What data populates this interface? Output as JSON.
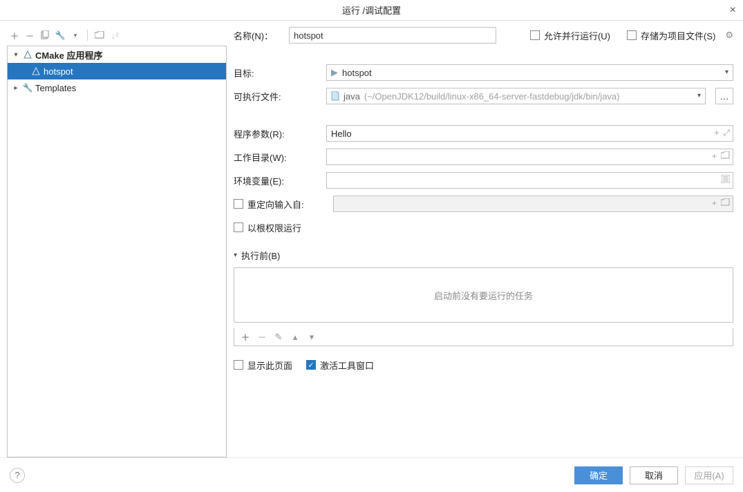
{
  "title": "运行 /调试配置",
  "toolbar": {
    "add": "+",
    "remove": "−",
    "copy": "⧉",
    "settings": "🔧"
  },
  "tree": {
    "cmake_apps": "CMake 应用程序",
    "hotspot": "hotspot",
    "templates": "Templates"
  },
  "form": {
    "name_label": "名称(N)：",
    "name_value": "hotspot",
    "allow_parallel": "允许并行运行(U)",
    "store_as_project": "存储为项目文件(S)",
    "target_label": "目标:",
    "target_value": "hotspot",
    "executable_label": "可执行文件:",
    "executable_name": "java",
    "executable_path": "(~/OpenJDK12/build/linux-x86_64-server-fastdebug/jdk/bin/java)",
    "args_label": "程序参数(R):",
    "args_value": "Hello",
    "wd_label": "工作目录(W):",
    "wd_value": "",
    "env_label": "环境变量(E):",
    "env_value": "",
    "redirect_label": "重定向输入自:",
    "root_label": "以根权限运行",
    "before_section": "执行前(B)",
    "before_empty": "启动前没有要运行的任务",
    "show_page": "显示此页面",
    "activate_tool": "激活工具窗口"
  },
  "footer": {
    "ok": "确定",
    "cancel": "取消",
    "apply": "应用(A)"
  }
}
